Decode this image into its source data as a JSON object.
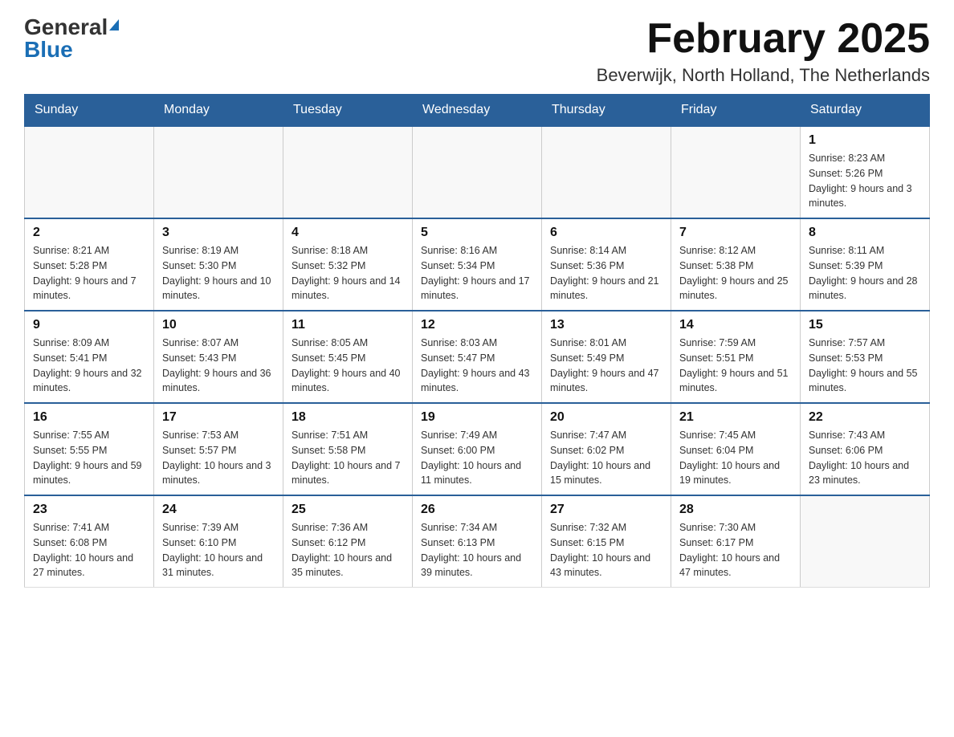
{
  "logo": {
    "text_general": "General",
    "text_blue": "Blue"
  },
  "header": {
    "month_year": "February 2025",
    "location": "Beverwijk, North Holland, The Netherlands"
  },
  "weekdays": [
    "Sunday",
    "Monday",
    "Tuesday",
    "Wednesday",
    "Thursday",
    "Friday",
    "Saturday"
  ],
  "weeks": [
    [
      {
        "day": "",
        "sunrise": "",
        "sunset": "",
        "daylight": ""
      },
      {
        "day": "",
        "sunrise": "",
        "sunset": "",
        "daylight": ""
      },
      {
        "day": "",
        "sunrise": "",
        "sunset": "",
        "daylight": ""
      },
      {
        "day": "",
        "sunrise": "",
        "sunset": "",
        "daylight": ""
      },
      {
        "day": "",
        "sunrise": "",
        "sunset": "",
        "daylight": ""
      },
      {
        "day": "",
        "sunrise": "",
        "sunset": "",
        "daylight": ""
      },
      {
        "day": "1",
        "sunrise": "Sunrise: 8:23 AM",
        "sunset": "Sunset: 5:26 PM",
        "daylight": "Daylight: 9 hours and 3 minutes."
      }
    ],
    [
      {
        "day": "2",
        "sunrise": "Sunrise: 8:21 AM",
        "sunset": "Sunset: 5:28 PM",
        "daylight": "Daylight: 9 hours and 7 minutes."
      },
      {
        "day": "3",
        "sunrise": "Sunrise: 8:19 AM",
        "sunset": "Sunset: 5:30 PM",
        "daylight": "Daylight: 9 hours and 10 minutes."
      },
      {
        "day": "4",
        "sunrise": "Sunrise: 8:18 AM",
        "sunset": "Sunset: 5:32 PM",
        "daylight": "Daylight: 9 hours and 14 minutes."
      },
      {
        "day": "5",
        "sunrise": "Sunrise: 8:16 AM",
        "sunset": "Sunset: 5:34 PM",
        "daylight": "Daylight: 9 hours and 17 minutes."
      },
      {
        "day": "6",
        "sunrise": "Sunrise: 8:14 AM",
        "sunset": "Sunset: 5:36 PM",
        "daylight": "Daylight: 9 hours and 21 minutes."
      },
      {
        "day": "7",
        "sunrise": "Sunrise: 8:12 AM",
        "sunset": "Sunset: 5:38 PM",
        "daylight": "Daylight: 9 hours and 25 minutes."
      },
      {
        "day": "8",
        "sunrise": "Sunrise: 8:11 AM",
        "sunset": "Sunset: 5:39 PM",
        "daylight": "Daylight: 9 hours and 28 minutes."
      }
    ],
    [
      {
        "day": "9",
        "sunrise": "Sunrise: 8:09 AM",
        "sunset": "Sunset: 5:41 PM",
        "daylight": "Daylight: 9 hours and 32 minutes."
      },
      {
        "day": "10",
        "sunrise": "Sunrise: 8:07 AM",
        "sunset": "Sunset: 5:43 PM",
        "daylight": "Daylight: 9 hours and 36 minutes."
      },
      {
        "day": "11",
        "sunrise": "Sunrise: 8:05 AM",
        "sunset": "Sunset: 5:45 PM",
        "daylight": "Daylight: 9 hours and 40 minutes."
      },
      {
        "day": "12",
        "sunrise": "Sunrise: 8:03 AM",
        "sunset": "Sunset: 5:47 PM",
        "daylight": "Daylight: 9 hours and 43 minutes."
      },
      {
        "day": "13",
        "sunrise": "Sunrise: 8:01 AM",
        "sunset": "Sunset: 5:49 PM",
        "daylight": "Daylight: 9 hours and 47 minutes."
      },
      {
        "day": "14",
        "sunrise": "Sunrise: 7:59 AM",
        "sunset": "Sunset: 5:51 PM",
        "daylight": "Daylight: 9 hours and 51 minutes."
      },
      {
        "day": "15",
        "sunrise": "Sunrise: 7:57 AM",
        "sunset": "Sunset: 5:53 PM",
        "daylight": "Daylight: 9 hours and 55 minutes."
      }
    ],
    [
      {
        "day": "16",
        "sunrise": "Sunrise: 7:55 AM",
        "sunset": "Sunset: 5:55 PM",
        "daylight": "Daylight: 9 hours and 59 minutes."
      },
      {
        "day": "17",
        "sunrise": "Sunrise: 7:53 AM",
        "sunset": "Sunset: 5:57 PM",
        "daylight": "Daylight: 10 hours and 3 minutes."
      },
      {
        "day": "18",
        "sunrise": "Sunrise: 7:51 AM",
        "sunset": "Sunset: 5:58 PM",
        "daylight": "Daylight: 10 hours and 7 minutes."
      },
      {
        "day": "19",
        "sunrise": "Sunrise: 7:49 AM",
        "sunset": "Sunset: 6:00 PM",
        "daylight": "Daylight: 10 hours and 11 minutes."
      },
      {
        "day": "20",
        "sunrise": "Sunrise: 7:47 AM",
        "sunset": "Sunset: 6:02 PM",
        "daylight": "Daylight: 10 hours and 15 minutes."
      },
      {
        "day": "21",
        "sunrise": "Sunrise: 7:45 AM",
        "sunset": "Sunset: 6:04 PM",
        "daylight": "Daylight: 10 hours and 19 minutes."
      },
      {
        "day": "22",
        "sunrise": "Sunrise: 7:43 AM",
        "sunset": "Sunset: 6:06 PM",
        "daylight": "Daylight: 10 hours and 23 minutes."
      }
    ],
    [
      {
        "day": "23",
        "sunrise": "Sunrise: 7:41 AM",
        "sunset": "Sunset: 6:08 PM",
        "daylight": "Daylight: 10 hours and 27 minutes."
      },
      {
        "day": "24",
        "sunrise": "Sunrise: 7:39 AM",
        "sunset": "Sunset: 6:10 PM",
        "daylight": "Daylight: 10 hours and 31 minutes."
      },
      {
        "day": "25",
        "sunrise": "Sunrise: 7:36 AM",
        "sunset": "Sunset: 6:12 PM",
        "daylight": "Daylight: 10 hours and 35 minutes."
      },
      {
        "day": "26",
        "sunrise": "Sunrise: 7:34 AM",
        "sunset": "Sunset: 6:13 PM",
        "daylight": "Daylight: 10 hours and 39 minutes."
      },
      {
        "day": "27",
        "sunrise": "Sunrise: 7:32 AM",
        "sunset": "Sunset: 6:15 PM",
        "daylight": "Daylight: 10 hours and 43 minutes."
      },
      {
        "day": "28",
        "sunrise": "Sunrise: 7:30 AM",
        "sunset": "Sunset: 6:17 PM",
        "daylight": "Daylight: 10 hours and 47 minutes."
      },
      {
        "day": "",
        "sunrise": "",
        "sunset": "",
        "daylight": ""
      }
    ]
  ]
}
